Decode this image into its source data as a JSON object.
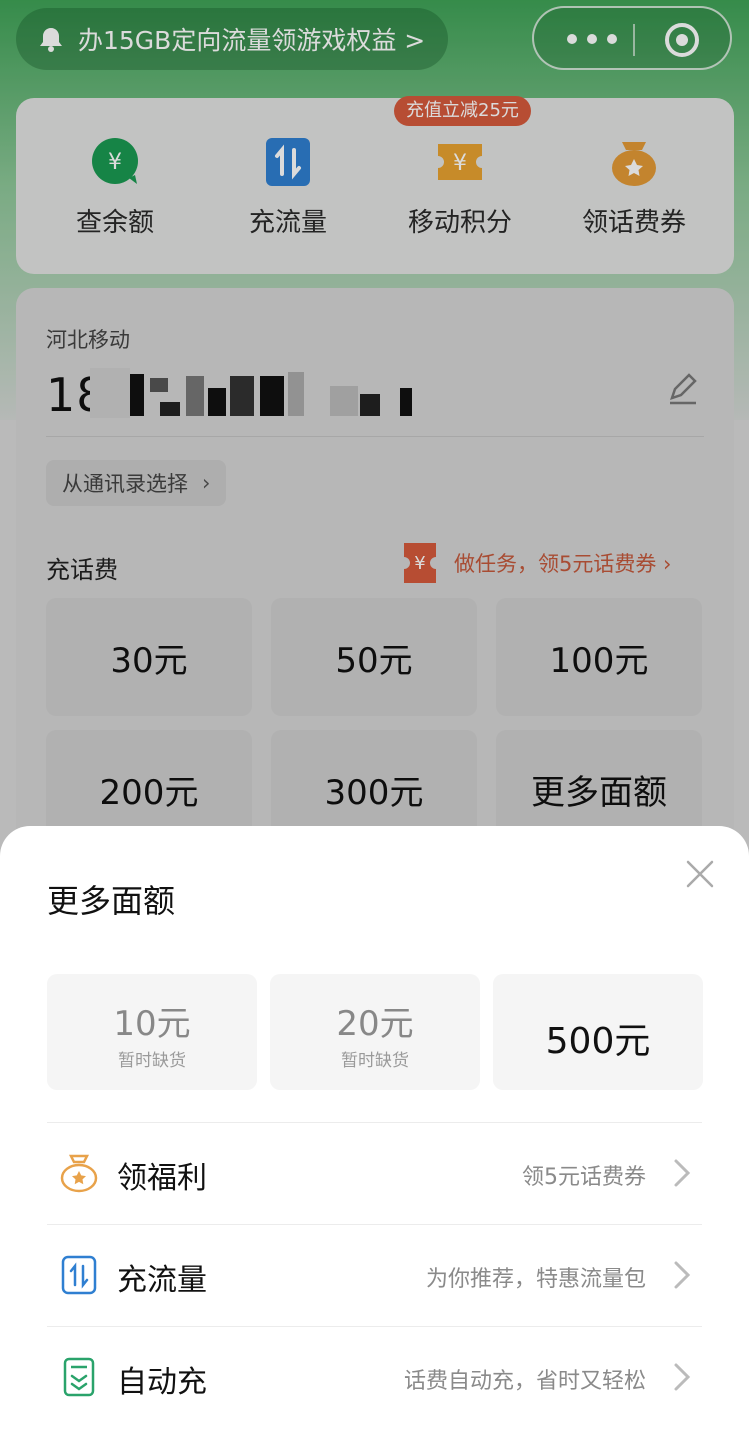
{
  "topbar": {
    "notice_text": "办15GB定向流量领游戏权益 >"
  },
  "quick_menu": {
    "items": [
      {
        "label": "查余额",
        "icon": "yuan-chat-icon"
      },
      {
        "label": "充流量",
        "icon": "data-transfer-icon"
      },
      {
        "label": "移动积分",
        "icon": "points-ticket-icon"
      },
      {
        "label": "领话费券",
        "icon": "coupon-bag-icon"
      }
    ],
    "badge": "充值立减25元"
  },
  "account": {
    "carrier": "河北移动",
    "phone_prefix": "18",
    "contacts_button": "从通讯录选择",
    "contacts_chevron": "›"
  },
  "recharge": {
    "title": "充话费",
    "task_link": "做任务，领5元话费券 ›",
    "amounts": [
      "30元",
      "50元",
      "100元",
      "200元",
      "300元",
      "更多面额"
    ]
  },
  "sheet": {
    "title": "更多面额",
    "amounts": [
      {
        "value": "10元",
        "status": "暂时缺货"
      },
      {
        "value": "20元",
        "status": "暂时缺货"
      },
      {
        "value": "500元",
        "status": ""
      }
    ],
    "rows": [
      {
        "label": "领福利",
        "sub": "领5元话费券",
        "icon": "coupon-bag-icon"
      },
      {
        "label": "充流量",
        "sub": "为你推荐，特惠流量包",
        "icon": "data-transfer-icon"
      },
      {
        "label": "自动充",
        "sub": "话费自动充，省时又轻松",
        "icon": "auto-recharge-icon"
      }
    ]
  },
  "colors": {
    "brand_green": "#1aa34a",
    "accent_orange": "#d65a3c",
    "icon_orange": "#e8a24a",
    "icon_blue": "#2f7fd1",
    "icon_teal": "#2aa36b"
  }
}
